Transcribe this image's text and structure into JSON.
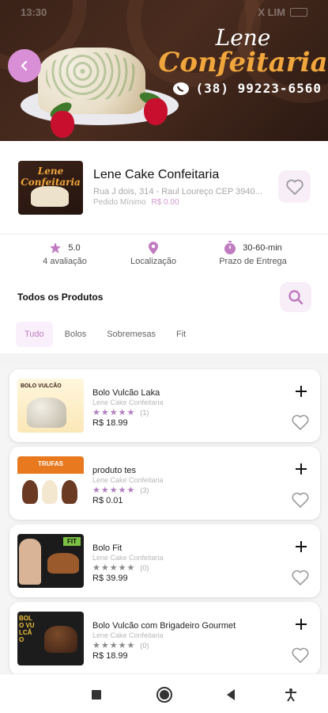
{
  "status_bar": {
    "time": "13:30",
    "right_text": "X LIM"
  },
  "header": {
    "brand_line1": "Lene",
    "brand_line2": "Confeitaria",
    "phone": "(38) 99223-6560",
    "colors": {
      "accent": "#d98fd6",
      "brand_gold": "#f0a63c",
      "banner_bg": "#3a2218"
    }
  },
  "store": {
    "logo_text": "Lene Confeitaria",
    "name": "Lene Cake Confeitaria",
    "address": "Rua J dois, 314 - Raul Loureço CEP 3940...",
    "min_label": "Pedido Mínimo",
    "min_value": "R$ 0.00"
  },
  "info": {
    "rating_value": "5.0",
    "rating_label": "4 avaliação",
    "location_label": "Localização",
    "delivery_value": "30-60-min",
    "delivery_label": "Prazo de Entrega"
  },
  "section": {
    "title": "Todos os Produtos"
  },
  "tabs": [
    {
      "label": "Tudo",
      "active": true
    },
    {
      "label": "Bolos",
      "active": false
    },
    {
      "label": "Sobremesas",
      "active": false
    },
    {
      "label": "Fit",
      "active": false
    }
  ],
  "products": [
    {
      "name": "Bolo Vulcão Laka",
      "store": "Lene Cake Confeitaria",
      "stars": 5,
      "count": "(1)",
      "price": "R$ 18.99",
      "thumb_text": "BOLO VULCÃO"
    },
    {
      "name": "produto tes",
      "store": "Lene Cake Confeitaria",
      "stars": 5,
      "count": "(3)",
      "price": "R$ 0.01",
      "thumb_text": "TRUFAS"
    },
    {
      "name": "Bolo Fit",
      "store": "Lene Cake Confeitaria",
      "stars": 0,
      "count": "(0)",
      "price": "R$ 39.99",
      "thumb_text": "FIT"
    },
    {
      "name": "Bolo Vulcão com Brigadeiro Gourmet",
      "store": "Lene Cake Confeitaria",
      "stars": 0,
      "count": "(0)",
      "price": "R$ 18.99",
      "thumb_text": "BOLO VULCÃO"
    }
  ]
}
